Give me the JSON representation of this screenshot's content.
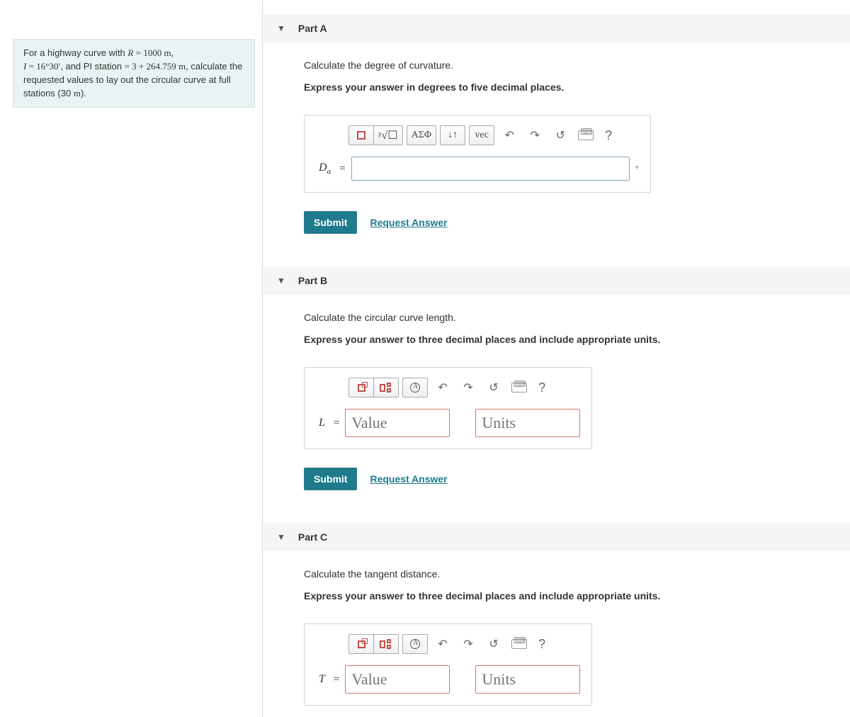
{
  "problem": {
    "line1_a": "For a highway curve with ",
    "R": "R",
    "eq1": " = ",
    "Rval": "1000 m",
    "line2_a": ", ",
    "I": "I",
    "Ival": "16°30′",
    "line2_b": ", and PI station ",
    "PIval": "3 + 264.759 m",
    "line3": ", calculate the requested values to lay out the circular curve at full stations (30 ",
    "m_unit": "m",
    "close": ")."
  },
  "parts": [
    {
      "title": "Part A",
      "instr1": "Calculate the degree of curvature.",
      "instr2": "Express your answer in degrees to five decimal places.",
      "var_label": "D",
      "var_sub": "a",
      "mode": "symbolic",
      "toolbar": {
        "symbol": "ΑΣΦ",
        "vec": "vec",
        "arrows": "↓↑"
      }
    },
    {
      "title": "Part B",
      "instr1": "Calculate the circular curve length.",
      "instr2": "Express your answer to three decimal places and include appropriate units.",
      "var_label": "L",
      "mode": "value_units"
    },
    {
      "title": "Part C",
      "instr1": "Calculate the tangent distance.",
      "instr2": "Express your answer to three decimal places and include appropriate units.",
      "var_label": "T",
      "mode": "value_units"
    }
  ],
  "common": {
    "submit": "Submit",
    "request": "Request Answer",
    "value_ph": "Value",
    "units_ph": "Units",
    "eq": "=",
    "deg": "°"
  }
}
